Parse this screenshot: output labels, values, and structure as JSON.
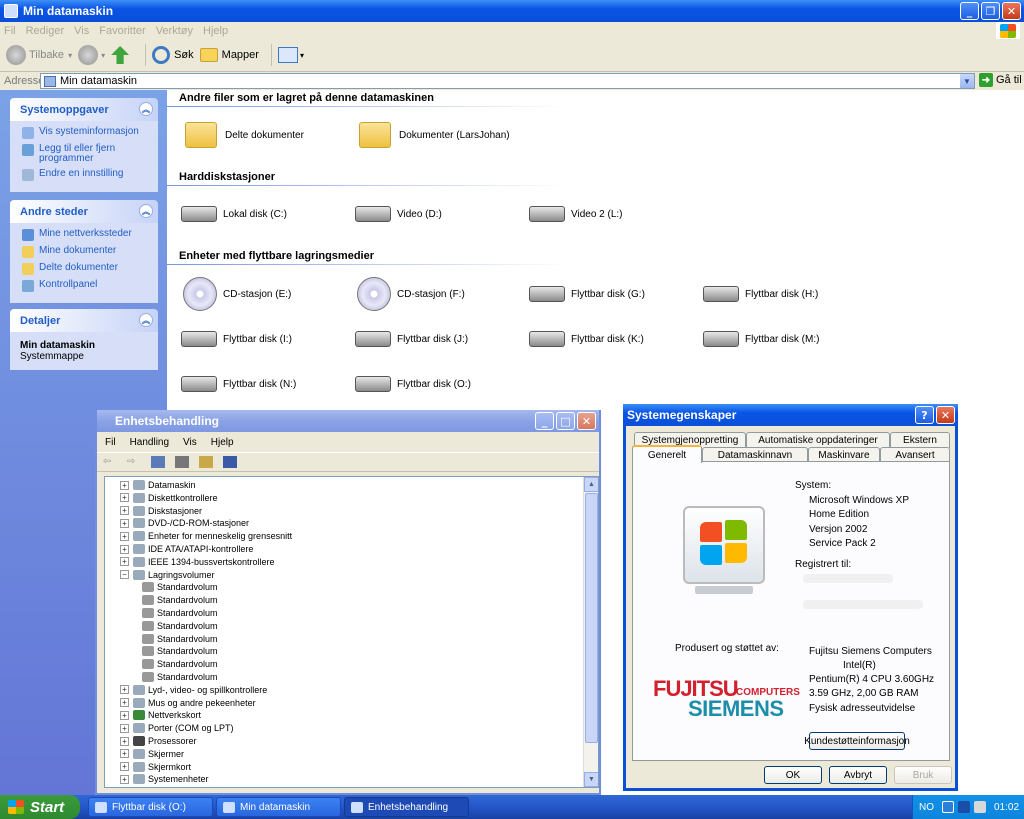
{
  "explorer": {
    "title": "Min datamaskin",
    "menu": [
      "Fil",
      "Rediger",
      "Vis",
      "Favoritter",
      "Verktøy",
      "Hjelp"
    ],
    "toolbar": {
      "back": "Tilbake",
      "search": "Søk",
      "folders": "Mapper"
    },
    "address": {
      "label": "Adresse",
      "value": "Min datamaskin",
      "go": "Gå til"
    },
    "sidebar": {
      "system_tasks": {
        "title": "Systemoppgaver",
        "items": [
          "Vis systeminformasjon",
          "Legg til eller fjern programmer",
          "Endre en innstilling"
        ]
      },
      "other_places": {
        "title": "Andre steder",
        "items": [
          "Mine nettverkssteder",
          "Mine dokumenter",
          "Delte dokumenter",
          "Kontrollpanel"
        ]
      },
      "details": {
        "title": "Detaljer",
        "name": "Min datamaskin",
        "type": "Systemmappe"
      }
    },
    "sections": {
      "shared": {
        "title": "Andre filer som er lagret på denne datamaskinen",
        "items": [
          "Delte dokumenter",
          "Dokumenter (LarsJohan)"
        ]
      },
      "hdd": {
        "title": "Harddiskstasjoner",
        "items": [
          "Lokal disk (C:)",
          "Video (D:)",
          "Video 2 (L:)"
        ]
      },
      "removable": {
        "title": "Enheter med flyttbare lagringsmedier",
        "items": [
          "CD-stasjon (E:)",
          "CD-stasjon (F:)",
          "Flyttbar disk (G:)",
          "Flyttbar disk (H:)",
          "Flyttbar disk (I:)",
          "Flyttbar disk (J:)",
          "Flyttbar disk (K:)",
          "Flyttbar disk (M:)",
          "Flyttbar disk (N:)",
          "Flyttbar disk (O:)"
        ]
      }
    }
  },
  "devmgr": {
    "title": "Enhetsbehandling",
    "menu": [
      "Fil",
      "Handling",
      "Vis",
      "Hjelp"
    ],
    "tree": [
      "Datamaskin",
      "Diskettkontrollere",
      "Diskstasjoner",
      "DVD-/CD-ROM-stasjoner",
      "Enheter for menneskelig grensesnitt",
      "IDE ATA/ATAPI-kontrollere",
      "IEEE 1394-bussvertskontrollere",
      "Lagringsvolumer",
      "Standardvolum",
      "Standardvolum",
      "Standardvolum",
      "Standardvolum",
      "Standardvolum",
      "Standardvolum",
      "Standardvolum",
      "Standardvolum",
      "Lyd-, video- og spillkontrollere",
      "Mus og andre pekeenheter",
      "Nettverkskort",
      "Porter (COM og LPT)",
      "Prosessorer",
      "Skjermer",
      "Skjermkort",
      "Systemenheter"
    ]
  },
  "sysprops": {
    "title": "Systemegenskaper",
    "tabs_row1": [
      "Systemgjenoppretting",
      "Automatiske oppdateringer",
      "Ekstern"
    ],
    "tabs_row2": [
      "Generelt",
      "Datamaskinnavn",
      "Maskinvare",
      "Avansert"
    ],
    "system_label": "System:",
    "system": [
      "Microsoft Windows XP",
      "Home Edition",
      "Versjon 2002",
      "Service Pack 2"
    ],
    "registered_label": "Registrert til:",
    "manufacturer_label": "Produsert og støttet av:",
    "logo": {
      "line1": "FUJITSU",
      "line1b": "COMPUTERS",
      "line2": "SIEMENS"
    },
    "manufacturer": [
      "Fujitsu Siemens Computers",
      "Intel(R)",
      "Pentium(R) 4 CPU 3.60GHz",
      "3.59 GHz, 2,00 GB RAM",
      "Fysisk adresseutvidelse"
    ],
    "support_button": "Kundestøtteinformasjon",
    "ok": "OK",
    "cancel": "Avbryt",
    "apply": "Bruk"
  },
  "taskbar": {
    "start": "Start",
    "tasks": [
      "Flyttbar disk (O:)",
      "Min datamaskin",
      "Enhetsbehandling"
    ],
    "lang": "NO",
    "clock": "01:02"
  }
}
